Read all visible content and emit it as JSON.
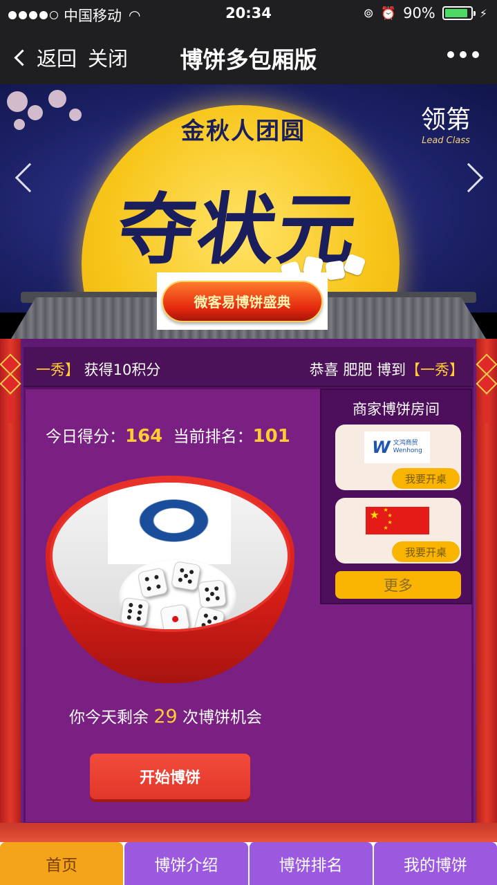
{
  "status_bar": {
    "carrier": "中国移动",
    "time": "20:34",
    "battery": "90%",
    "battery_level": 0.9
  },
  "nav": {
    "back_label": "返回",
    "close_label": "关闭",
    "title": "博饼多包厢版"
  },
  "banner": {
    "subtitle": "金秋人团圆",
    "main": "夺状元",
    "brand_cn": "领第",
    "brand_en": "Lead Class",
    "button_label": "微客易博饼盛典"
  },
  "ticker": {
    "left_name": "一秀】",
    "left_text": " 获得10积分",
    "right_prefix": "恭喜 肥肥 博到",
    "right_award": "【一秀】"
  },
  "score": {
    "today_label": "今日得分：",
    "today_value": "164",
    "rank_label": "当前排名：",
    "rank_value": "101"
  },
  "chances": {
    "prefix": "你今天剩余",
    "value": "29",
    "suffix": "次博饼机会"
  },
  "start_button": "开始博饼",
  "merchant": {
    "title": "商家博饼房间",
    "rooms": [
      {
        "logo_text": "文鸿商贸",
        "logo_sub": "Wenhong",
        "open_label": "我要开桌"
      },
      {
        "open_label": "我要开桌"
      }
    ],
    "more_label": "更多"
  },
  "tabs": [
    {
      "label": "首页"
    },
    {
      "label": "博饼介绍"
    },
    {
      "label": "博饼排名"
    },
    {
      "label": "我的博饼"
    }
  ]
}
